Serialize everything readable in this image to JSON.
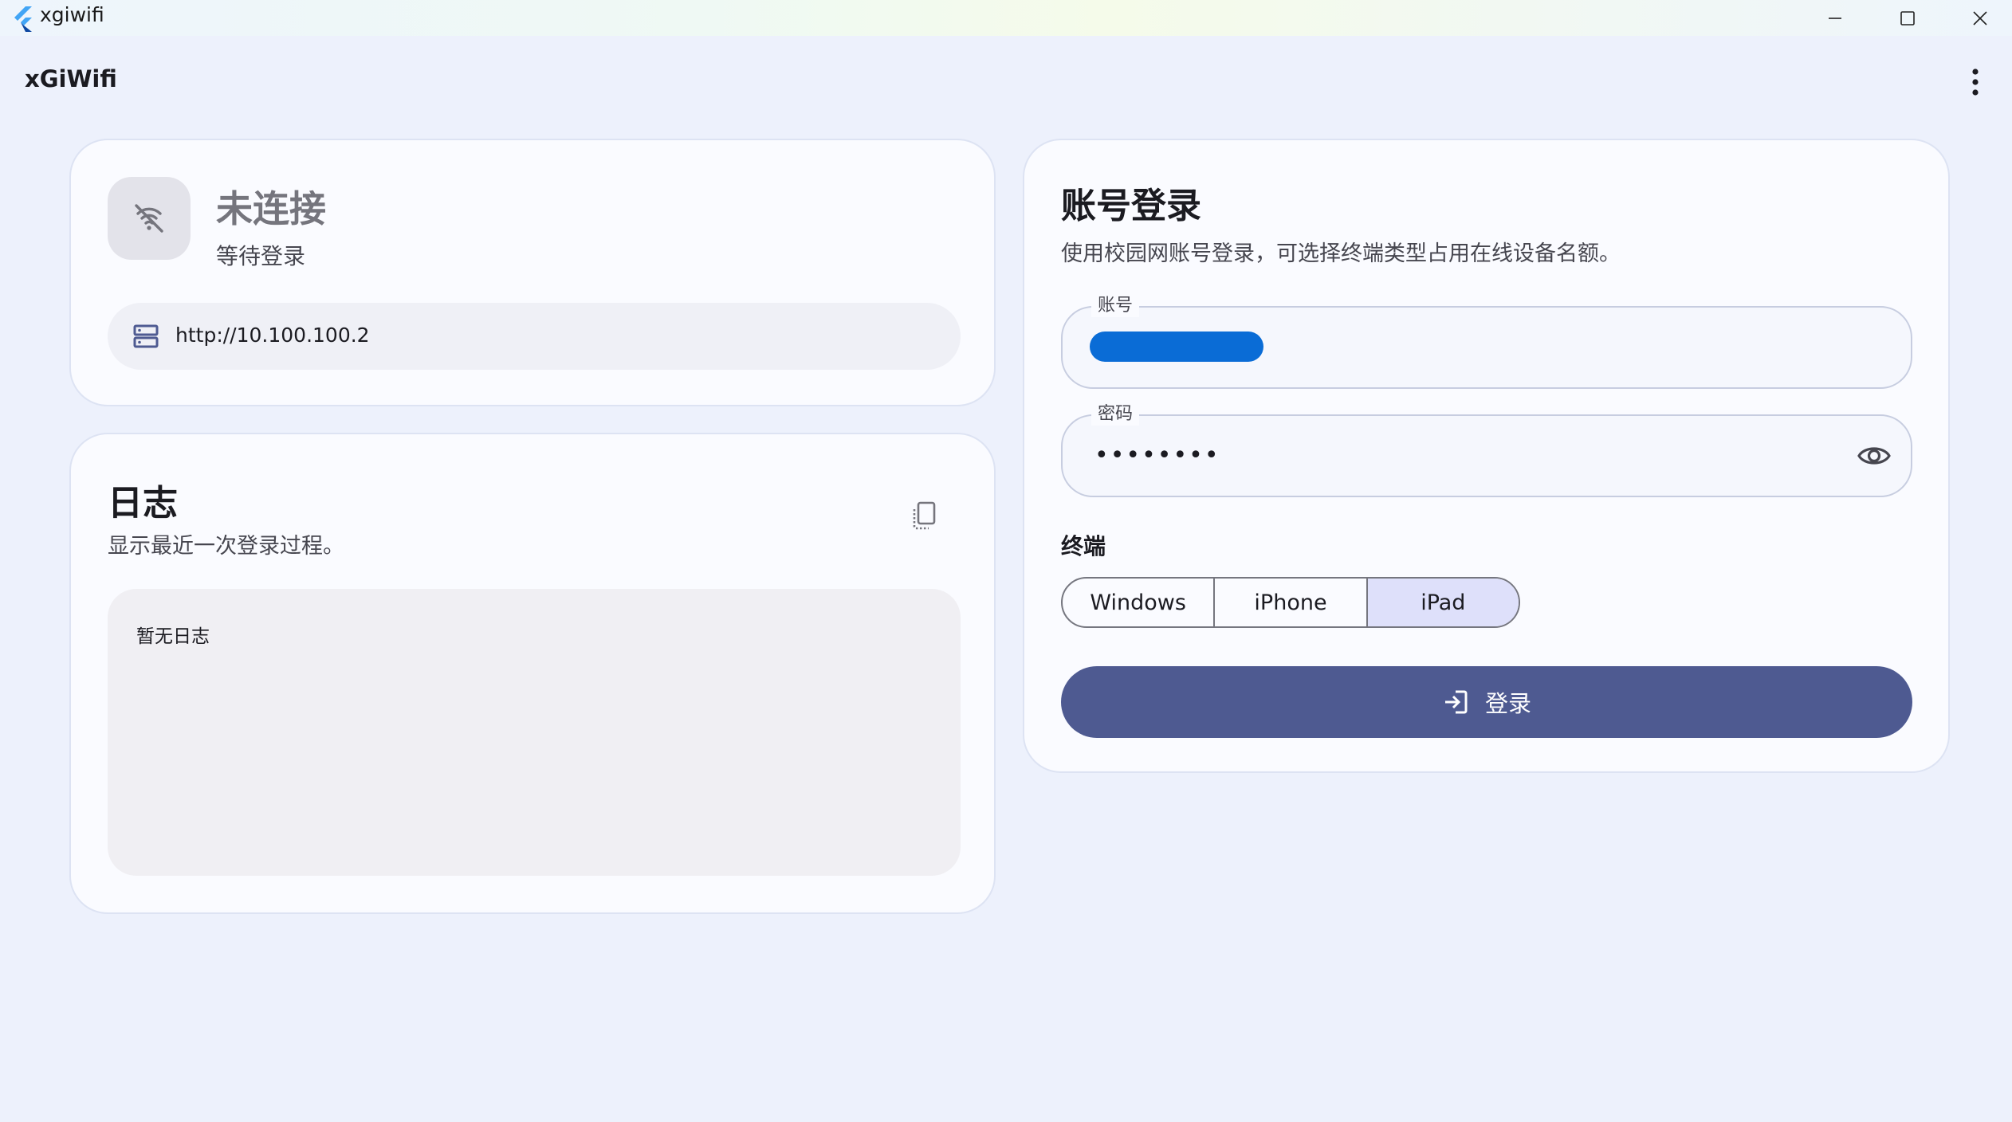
{
  "window": {
    "title": "xgiwifi",
    "logo_icon": "flutter-logo"
  },
  "appbar": {
    "title": "xGiWifi",
    "menu_icon": "more-vert-icon"
  },
  "status": {
    "title": "未连接",
    "subtitle": "等待登录",
    "icon": "wifi-off-icon",
    "server_url": "http://10.100.100.2"
  },
  "log": {
    "title": "日志",
    "subtitle": "显示最近一次登录过程。",
    "empty_text": "暂无日志",
    "copy_icon": "copy-icon"
  },
  "login": {
    "title": "账号登录",
    "subtitle": "使用校园网账号登录，可选择终端类型占用在线设备名额。",
    "account_label": "账号",
    "account_value_redacted": true,
    "password_label": "密码",
    "password_value": "••••••••",
    "terminal_label": "终端",
    "terminals": [
      "Windows",
      "iPhone",
      "iPad"
    ],
    "selected_terminal": "iPad",
    "submit_label": "登录"
  },
  "colors": {
    "background": "#edf1fc",
    "card": "#fafbff",
    "primary": "#4e5a91",
    "segment_selected": "#dee0fa",
    "redaction": "#0a6cd6"
  }
}
